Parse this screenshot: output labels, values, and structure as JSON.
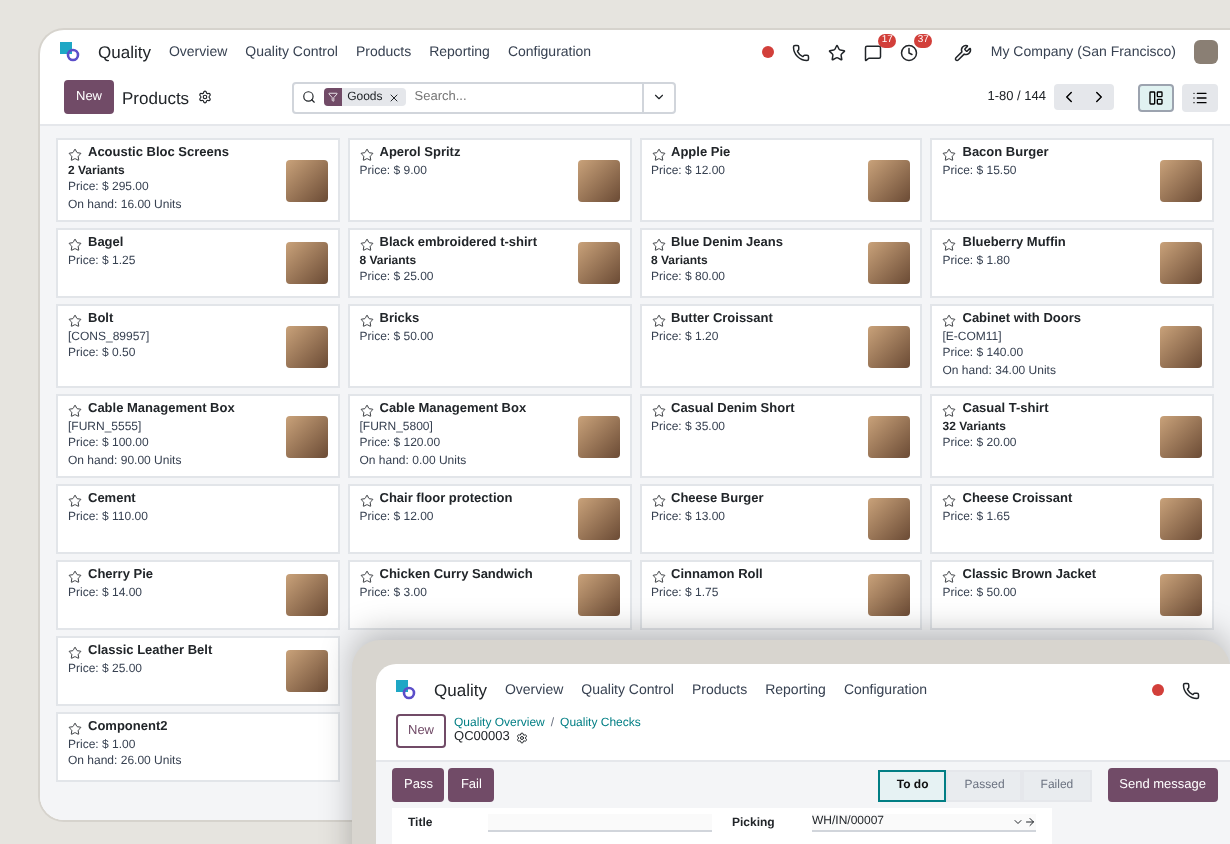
{
  "app": {
    "name": "Quality",
    "menu": [
      "Overview",
      "Quality Control",
      "Products",
      "Reporting",
      "Configuration"
    ]
  },
  "systray": {
    "badges": [
      "17",
      "37"
    ],
    "company": "My Company (San Francisco)"
  },
  "control": {
    "new": "New",
    "title": "Products",
    "facet": "Goods",
    "placeholder": "Search...",
    "pager": "1-80 / 144",
    "views": [
      {
        "kind": "kanban",
        "selected": true
      },
      {
        "kind": "list",
        "selected": false
      }
    ]
  },
  "rows": [
    [
      {
        "name": "Acoustic Bloc Screens",
        "variants": "2 Variants",
        "price": "Price: $ 295.00",
        "on_hand": "On hand: 16.00 Units",
        "image": true
      },
      {
        "name": "Aperol Spritz",
        "price": "Price: $ 9.00",
        "image": true
      },
      {
        "name": "Apple Pie",
        "price": "Price: $ 12.00",
        "image": true
      },
      {
        "name": "Bacon Burger",
        "price": "Price: $ 15.50",
        "image": true
      }
    ],
    [
      {
        "name": "Bagel",
        "price": "Price: $ 1.25",
        "image": true
      },
      {
        "name": "Black embroidered t-shirt",
        "variants": "8 Variants",
        "price": "Price: $ 25.00",
        "image": true
      },
      {
        "name": "Blue Denim Jeans",
        "variants": "8 Variants",
        "price": "Price: $ 80.00",
        "image": true
      },
      {
        "name": "Blueberry Muffin",
        "price": "Price: $ 1.80",
        "image": true
      }
    ],
    [
      {
        "name": "Bolt",
        "ref": "[CONS_89957]",
        "price": "Price: $ 0.50",
        "image": true
      },
      {
        "name": "Bricks",
        "price": "Price: $ 50.00",
        "image": false
      },
      {
        "name": "Butter Croissant",
        "price": "Price: $ 1.20",
        "image": true
      },
      {
        "name": "Cabinet with Doors",
        "ref": "[E-COM11]",
        "price": "Price: $ 140.00",
        "on_hand": "On hand: 34.00 Units",
        "image": true
      }
    ],
    [
      {
        "name": "Cable Management Box",
        "ref": "[FURN_5555]",
        "price": "Price: $ 100.00",
        "on_hand": "On hand: 90.00 Units",
        "image": true
      },
      {
        "name": "Cable Management Box",
        "ref": "[FURN_5800]",
        "price": "Price: $ 120.00",
        "on_hand": "On hand: 0.00 Units",
        "image": true
      },
      {
        "name": "Casual Denim Short",
        "price": "Price: $ 35.00",
        "image": true
      },
      {
        "name": "Casual T-shirt",
        "variants": "32 Variants",
        "price": "Price: $ 20.00",
        "image": true
      }
    ],
    [
      {
        "name": "Cement",
        "price": "Price: $ 110.00",
        "image": false
      },
      {
        "name": "Chair floor protection",
        "price": "Price: $ 12.00",
        "image": true
      },
      {
        "name": "Cheese Burger",
        "price": "Price: $ 13.00",
        "image": true
      },
      {
        "name": "Cheese Croissant",
        "price": "Price: $ 1.65",
        "image": true
      }
    ],
    [
      {
        "name": "Cherry Pie",
        "price": "Price: $ 14.00",
        "image": true
      },
      {
        "name": "Chicken Curry Sandwich",
        "price": "Price: $ 3.00",
        "image": true
      },
      {
        "name": "Cinnamon Roll",
        "price": "Price: $ 1.75",
        "image": true
      },
      {
        "name": "Classic Brown Jacket",
        "price": "Price: $ 50.00",
        "image": true
      }
    ],
    [
      {
        "name": "Classic Leather Belt",
        "price": "Price: $ 25.00",
        "image": true
      }
    ],
    [
      {
        "name": "Component2",
        "price": "Price: $ 1.00",
        "on_hand": "On hand: 26.00 Units",
        "image": false
      }
    ]
  ],
  "overlay": {
    "app": "Quality",
    "menu": [
      "Overview",
      "Quality Control",
      "Products",
      "Reporting",
      "Configuration"
    ],
    "new": "New",
    "breadcrumb": [
      "Quality Overview",
      "Quality Checks"
    ],
    "separator": "/",
    "record": "QC00003",
    "actions": [
      "Pass",
      "Fail"
    ],
    "stages": [
      {
        "label": "To do",
        "selected": true
      },
      {
        "label": "Passed",
        "selected": false
      },
      {
        "label": "Failed",
        "selected": false
      }
    ],
    "send": "Send message",
    "fields": [
      {
        "label": "Title"
      },
      {
        "label": "Picking",
        "value": "WH/IN/00007"
      }
    ]
  }
}
